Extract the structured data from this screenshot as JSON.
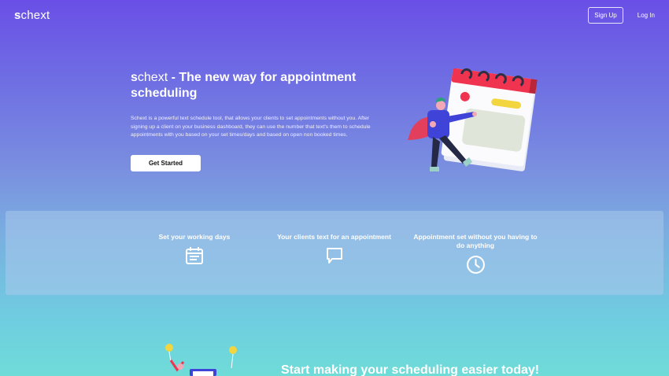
{
  "nav": {
    "logo_first": "s",
    "logo_rest": "chext",
    "signup_label": "Sign Up",
    "login_label": "Log In"
  },
  "hero": {
    "brand_first": "s",
    "brand_rest": "chext",
    "title_rest": " - The new way for appointment scheduling",
    "description": "Schext is a powerful text schedule tool, that allows your clients to set appointments without you. After signing up a client on your business dashboard, they can use the number that text's them to schedule appointments with you based on your set times/days and based on open non booked times.",
    "cta_label": "Get Started"
  },
  "features": [
    {
      "title": "Set your working days",
      "icon": "calendar-icon"
    },
    {
      "title": "Your clients text for an appointment",
      "icon": "message-icon"
    },
    {
      "title": "Appointment set without you having to do anything",
      "icon": "clock-icon"
    }
  ],
  "cta_section": {
    "title": "Start making your scheduling easier today!"
  },
  "colors": {
    "calendar_red": "#f0334f",
    "accent_yellow": "#f3d53f",
    "figure_blue": "#3f43d8"
  }
}
